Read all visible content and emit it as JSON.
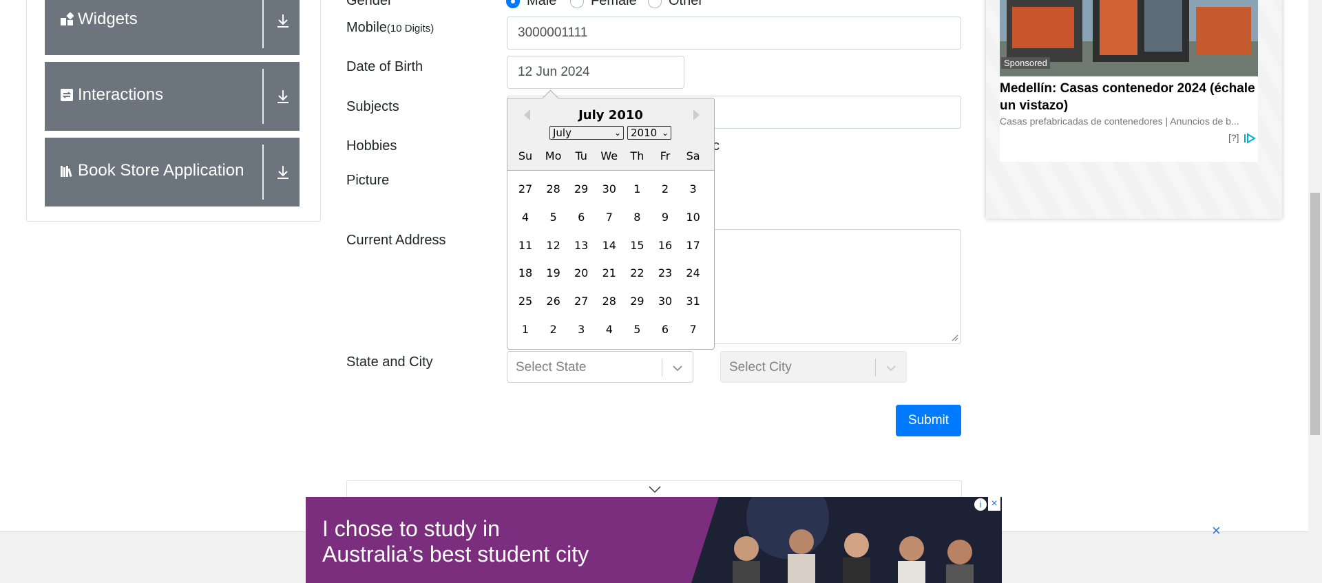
{
  "sidebar": {
    "groups": [
      {
        "label": "Widgets",
        "icon": "widgets-icon"
      },
      {
        "label": "Interactions",
        "icon": "interactions-icon"
      },
      {
        "label": "Book Store Application",
        "icon": "book-store-icon"
      }
    ]
  },
  "form": {
    "gender": {
      "label": "Gender",
      "options": [
        "Male",
        "Female",
        "Other"
      ],
      "selected": "Male"
    },
    "mobile": {
      "label": "Mobile",
      "hint": "(10 Digits)",
      "value": "3000001111"
    },
    "dob": {
      "label": "Date of Birth",
      "value": "12 Jun 2024"
    },
    "subjects": {
      "label": "Subjects"
    },
    "hobbies": {
      "label": "Hobbies",
      "partial_text": "c"
    },
    "picture": {
      "label": "Picture"
    },
    "address": {
      "label": "Current Address"
    },
    "state_city": {
      "label": "State and City",
      "state_placeholder": "Select State",
      "city_placeholder": "Select City"
    },
    "submit_label": "Submit"
  },
  "datepicker": {
    "title": "July 2010",
    "month_select": "July",
    "year_select": "2010",
    "day_names": [
      "Su",
      "Mo",
      "Tu",
      "We",
      "Th",
      "Fr",
      "Sa"
    ],
    "weeks": [
      [
        "27",
        "28",
        "29",
        "30",
        "1",
        "2",
        "3"
      ],
      [
        "4",
        "5",
        "6",
        "7",
        "8",
        "9",
        "10"
      ],
      [
        "11",
        "12",
        "13",
        "14",
        "15",
        "16",
        "17"
      ],
      [
        "18",
        "19",
        "20",
        "21",
        "22",
        "23",
        "24"
      ],
      [
        "25",
        "26",
        "27",
        "28",
        "29",
        "30",
        "31"
      ],
      [
        "1",
        "2",
        "3",
        "4",
        "5",
        "6",
        "7"
      ]
    ]
  },
  "ad_right": {
    "badge": "Sponsored",
    "headline": "Medellín: Casas contenedor 2024 (échale un vistazo)",
    "source": "Casas prefabricadas de contenedores | Anuncios de b...",
    "help": "[?]"
  },
  "banner": {
    "line1": "I chose to study in",
    "line2": "Australia’s best student city"
  },
  "colors": {
    "primary": "#007bff",
    "menu": "#6c757d",
    "banner": "#7b2d7e"
  }
}
